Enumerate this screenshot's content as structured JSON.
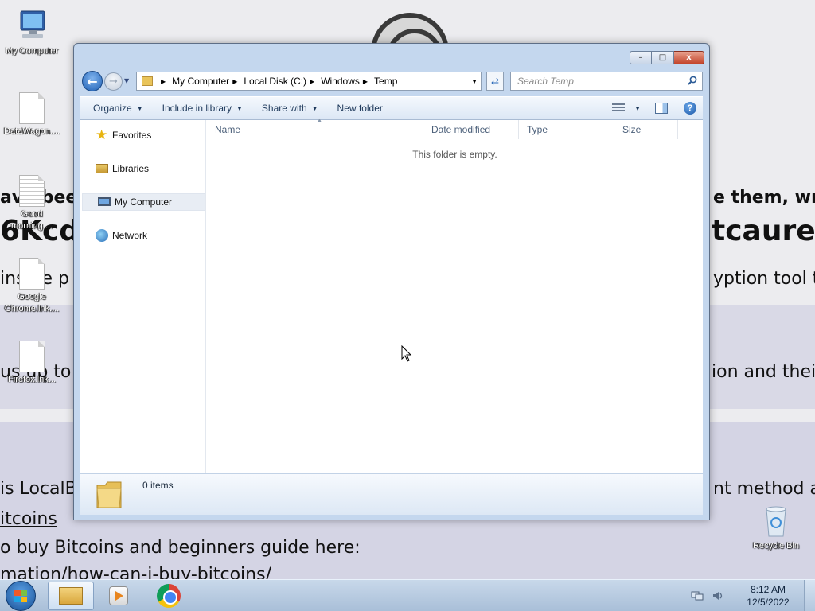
{
  "wallpaper": {
    "lines": [
      {
        "text": "!",
        "cls": "wp-big"
      },
      {
        "text": "ave been",
        "cls": "wp-mid"
      },
      {
        "text": "e them, write",
        "cls": "wp-mid"
      },
      {
        "text": "6Kcdk",
        "cls": "wp-big"
      },
      {
        "text": "tcauresan",
        "cls": "wp-big"
      },
      {
        "text": "ins he p",
        "cls": "wp-mid"
      },
      {
        "text": "yption tool that",
        "cls": "wp-mid"
      },
      {
        "text": "us up to 3",
        "cls": "wp-mid"
      },
      {
        "text": "ion and their t",
        "cls": "wp-mid"
      },
      {
        "text": "is LocalBi",
        "cls": "wp-mid"
      },
      {
        "text": "nt method and",
        "cls": "wp-mid"
      },
      {
        "text": "itcoins",
        "cls": "wp-mid"
      },
      {
        "text": "o buy Bitcoins and beginners guide here:",
        "cls": "wp-mid"
      },
      {
        "text": "mation/how-can-i-buy-bitcoins/",
        "cls": "wp-mid"
      }
    ]
  },
  "desktop": {
    "icons": [
      {
        "label": "My Computer"
      },
      {
        "label": "DataWagon...."
      },
      {
        "label": "Good morning...."
      },
      {
        "label": "Google Chrome.lnk...."
      },
      {
        "label": "Firefox.lnk..."
      },
      {
        "label": "Recycle Bin"
      }
    ]
  },
  "window": {
    "caption": {
      "minimize": "–",
      "maximize": "□",
      "close": "x"
    },
    "address": {
      "crumbs": [
        "My Computer",
        "Local Disk (C:)",
        "Windows",
        "Temp"
      ]
    },
    "search": {
      "placeholder": "Search Temp"
    },
    "toolbar": {
      "organize": "Organize",
      "include_in_library": "Include in library",
      "share_with": "Share with",
      "new_folder": "New folder",
      "help": "?"
    },
    "nav": {
      "items": [
        {
          "label": "Favorites",
          "icon": "star-icon"
        },
        {
          "label": "Libraries",
          "icon": "libraries-icon"
        },
        {
          "label": "My Computer",
          "icon": "computer-icon",
          "selected": true
        },
        {
          "label": "Network",
          "icon": "network-icon"
        }
      ]
    },
    "columns": [
      "Name",
      "Date modified",
      "Type",
      "Size"
    ],
    "empty_message": "This folder is empty.",
    "details": {
      "items_count": "0 items"
    }
  },
  "taskbar": {
    "apps": [
      {
        "name": "Windows Explorer",
        "icon": "explorer-icon",
        "active": true
      },
      {
        "name": "Windows Media Player",
        "icon": "media-player-icon"
      },
      {
        "name": "Google Chrome",
        "icon": "chrome-icon"
      }
    ],
    "clock": {
      "time": "8:12 AM",
      "date": "12/5/2022"
    }
  },
  "colors": {
    "window_frame": "#c4d7ee",
    "toolbar_text": "#1e395b",
    "taskbar": "#b9cde3"
  }
}
